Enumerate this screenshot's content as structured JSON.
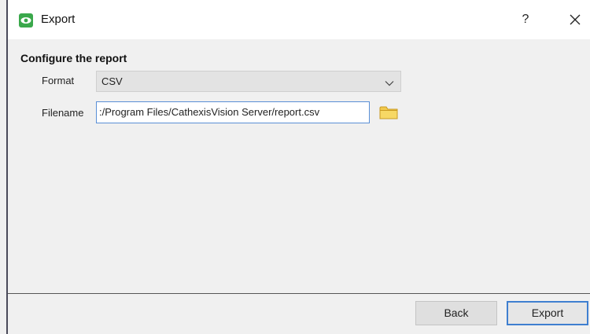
{
  "window": {
    "title": "Export",
    "help_label": "?",
    "icons": {
      "app": "eye-icon",
      "close": "close-icon",
      "browse": "folder-icon",
      "dropdown": "chevron-down-icon"
    },
    "accent_color": "#3f7fd0",
    "app_icon_color": "#3aa84b"
  },
  "form": {
    "section_title": "Configure the report",
    "format_label": "Format",
    "format_value": "CSV",
    "filename_label": "Filename",
    "filename_value": ":/Program Files/CathexisVision Server/report.csv"
  },
  "footer": {
    "back_label": "Back",
    "export_label": "Export"
  }
}
